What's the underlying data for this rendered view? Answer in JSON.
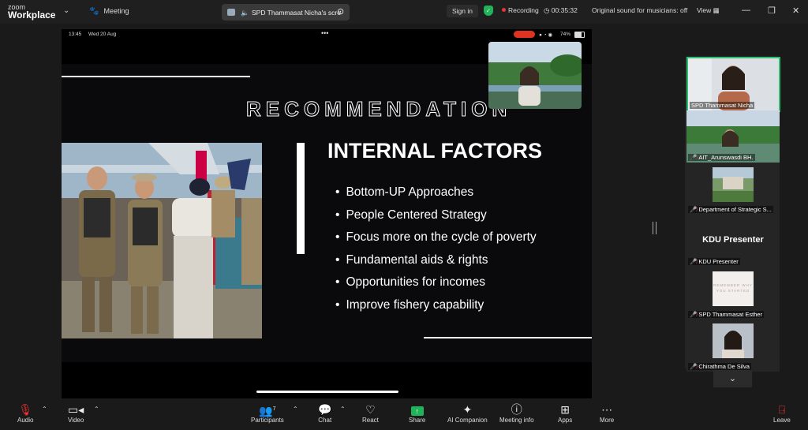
{
  "app": {
    "logo_line1": "zoom",
    "logo_line2": "Workplace"
  },
  "topbar": {
    "meeting_label": "Meeting",
    "share_tab_title": "SPD Thammasat Nicha's scre",
    "sign_in": "Sign in",
    "recording": "Recording",
    "timer": "00:35:32",
    "original_sound": "Original sound for musicians: off",
    "view": "View"
  },
  "shared_screen": {
    "status_time": "13:45",
    "status_date": "Wed 20 Aug",
    "battery": "74%",
    "slide_title": "RECOMMENDATION",
    "slide_heading": "INTERNAL FACTORS",
    "bullets": [
      "Bottom-UP Approaches",
      "People Centered Strategy",
      "Focus more on the cycle of poverty",
      "Fundamental aids & rights",
      "Opportunities for incomes",
      "Improve fishery capability"
    ]
  },
  "participants_panel": {
    "tiles": [
      {
        "name": "SPD Thammasat Nicha"
      },
      {
        "name": "AIT_Arunswasdi BH."
      },
      {
        "name": "Department of Strategic S..."
      },
      {
        "name": "KDU Presenter",
        "big_label": "KDU Presenter"
      },
      {
        "name": "SPD Thammasat Esther",
        "card_text": "REMEMBER WHY YOU STARTED"
      },
      {
        "name": "Chirathma De Silva"
      }
    ]
  },
  "toolbar": {
    "audio": "Audio",
    "video": "Video",
    "participants": "Participants",
    "participants_count": "7",
    "chat": "Chat",
    "react": "React",
    "share": "Share",
    "ai_companion": "AI Companion",
    "meeting_info": "Meeting info",
    "apps": "Apps",
    "more": "More",
    "leave": "Leave"
  },
  "colors": {
    "accent_green": "#1fb35a",
    "recording_red": "#e33333",
    "active_speaker": "#2fbf71"
  }
}
